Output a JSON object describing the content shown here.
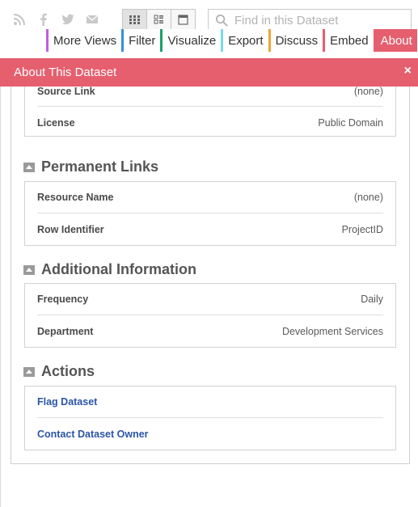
{
  "search": {
    "placeholder": "Find in this Dataset"
  },
  "share": {
    "icons": [
      "rss-icon",
      "facebook-icon",
      "twitter-icon",
      "email-icon"
    ]
  },
  "view_switch": {
    "icons": [
      "grid-view-icon",
      "list-view-icon",
      "page-view-icon"
    ]
  },
  "tabs": [
    {
      "label": "More Views",
      "color": "#c260e0"
    },
    {
      "label": "Filter",
      "color": "#3a8fd6"
    },
    {
      "label": "Visualize",
      "color": "#1aa06a"
    },
    {
      "label": "Export",
      "color": "#7ad9e8"
    },
    {
      "label": "Discuss",
      "color": "#f0a23a"
    },
    {
      "label": "Embed",
      "color": "#e55f6f"
    },
    {
      "label": "About",
      "color": "#e55f6f",
      "active": true
    }
  ],
  "pane": {
    "title": "About This Dataset",
    "close": "×",
    "accent": "#e55f6f"
  },
  "source_card": {
    "rows": [
      {
        "label": "Source Link",
        "value": "(none)"
      },
      {
        "label": "License",
        "value": "Public Domain"
      }
    ]
  },
  "permanent_links": {
    "title": "Permanent Links",
    "rows": [
      {
        "label": "Resource Name",
        "value": "(none)"
      },
      {
        "label": "Row Identifier",
        "value": "ProjectID"
      }
    ]
  },
  "additional_info": {
    "title": "Additional Information",
    "rows": [
      {
        "label": "Frequency",
        "value": "Daily"
      },
      {
        "label": "Department",
        "value": "Development Services"
      }
    ]
  },
  "actions": {
    "title": "Actions",
    "links": [
      "Flag Dataset",
      "Contact Dataset Owner"
    ],
    "link_color": "#2a55a5"
  }
}
